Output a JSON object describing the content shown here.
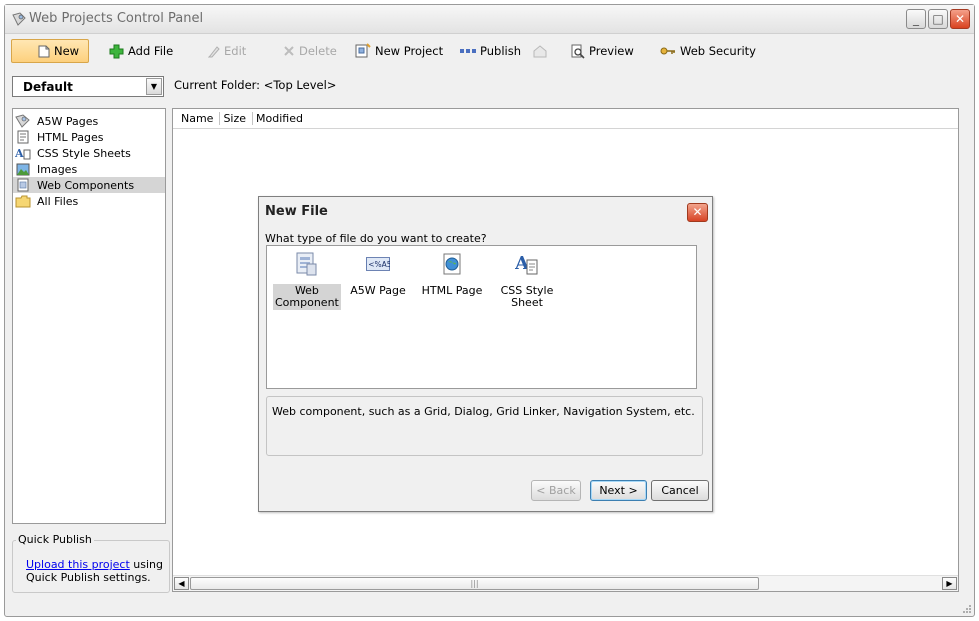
{
  "window": {
    "title": "Web Projects Control Panel",
    "minimize": "_",
    "maximize": "□",
    "close": "✕"
  },
  "toolbar": {
    "new": "New",
    "add_file": "Add File",
    "edit": "Edit",
    "delete": "Delete",
    "new_project": "New Project",
    "publish": "Publish",
    "preview": "Preview",
    "web_security": "Web Security"
  },
  "project_select": {
    "value": "Default",
    "arrow": "▼"
  },
  "current_folder": {
    "label": "Current Folder:",
    "value": "<Top Level>"
  },
  "tree": {
    "items": [
      {
        "label": "A5W Pages",
        "icon": "a5w-pages-icon"
      },
      {
        "label": "HTML Pages",
        "icon": "html-pages-icon"
      },
      {
        "label": "CSS Style Sheets",
        "icon": "css-icon"
      },
      {
        "label": "Images",
        "icon": "images-icon"
      },
      {
        "label": "Web Components",
        "icon": "web-components-icon",
        "selected": true
      },
      {
        "label": "All Files",
        "icon": "folder-icon"
      }
    ]
  },
  "quick_publish": {
    "title": "Quick Publish",
    "link": "Upload this project",
    "text_after": " using Quick Publish settings."
  },
  "file_list": {
    "columns": [
      "Name",
      "Size",
      "Modified"
    ],
    "scroll_left": "◀",
    "scroll_right": "▶",
    "thumb_grip": "|||"
  },
  "dialog": {
    "title": "New File",
    "close": "✕",
    "question": "What type of file do you want to create?",
    "types": [
      {
        "label": "Web Component",
        "line1": "Web",
        "line2": "Component",
        "icon": "web-component-icon",
        "selected": true
      },
      {
        "label": "A5W Page",
        "line1": "A5W Page",
        "line2": "",
        "icon": "a5w-page-icon",
        "icon_text": "<%A5"
      },
      {
        "label": "HTML Page",
        "line1": "HTML Page",
        "line2": "",
        "icon": "html-page-icon"
      },
      {
        "label": "CSS Style Sheet",
        "line1": "CSS Style",
        "line2": "Sheet",
        "icon": "css-style-sheet-icon"
      }
    ],
    "description": "Web component, such as a Grid, Dialog, Grid Linker, Navigation System, etc.",
    "back_button": "< Back",
    "next_button": "Next >",
    "cancel_button": "Cancel"
  },
  "colors": {
    "active_button": "#fdd07d",
    "selection": "#d5d5d5",
    "close_red": "#d74426",
    "link": "#0000ee"
  }
}
